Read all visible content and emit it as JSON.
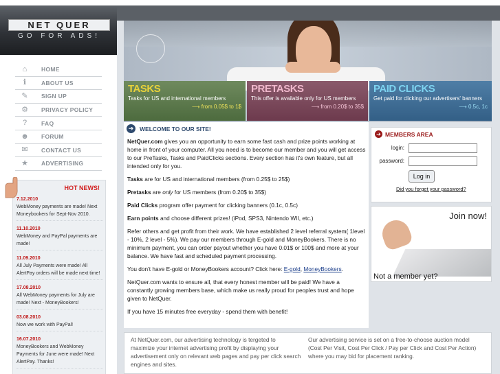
{
  "logo": {
    "name": "NET QUER",
    "tagline": "GO FOR ADS!"
  },
  "nav": [
    {
      "label": "HOME",
      "icon": "home-icon",
      "glyph": "⌂"
    },
    {
      "label": "ABOUT US",
      "icon": "info-icon",
      "glyph": "ℹ"
    },
    {
      "label": "SIGN UP",
      "icon": "pencil-icon",
      "glyph": "✎"
    },
    {
      "label": "PRIVACY POLICY",
      "icon": "gears-icon",
      "glyph": "⚙"
    },
    {
      "label": "FAQ",
      "icon": "question-icon",
      "glyph": "?"
    },
    {
      "label": "FORUM",
      "icon": "people-icon",
      "glyph": "☻"
    },
    {
      "label": "CONTACT US",
      "icon": "envelope-icon",
      "glyph": "✉"
    },
    {
      "label": "ADVERTISING",
      "icon": "star-icon",
      "glyph": "★"
    }
  ],
  "news": {
    "title": "HOT NEWS!",
    "items": [
      {
        "date": "7.12.2010",
        "text": "WebMoney payments are made! Next Moneybookers for Sept-Nov 2010."
      },
      {
        "date": "11.10.2010",
        "text": "WebMoney and PayPal payments are made!"
      },
      {
        "date": "11.09.2010",
        "text": "All July Payments were made! All AlertPay orders will be made next time!"
      },
      {
        "date": "17.08.2010",
        "text": "All WebMoney payments for July are made! Next - MoneyBookers!"
      },
      {
        "date": "03.08.2010",
        "text": "Now we work with PayPal!"
      },
      {
        "date": "16.07.2010",
        "text": "MoneyBookers and WebMoney Payments for June were made! Next AlertPay. Thanks!"
      }
    ]
  },
  "panels": [
    {
      "title": "TASKS",
      "text": "Tasks for US and international members",
      "price": "from 0.05$ to 1$"
    },
    {
      "title": "PRETASKS",
      "text": "This offer is available only for US members",
      "price": "from 0.20$ to 35$"
    },
    {
      "title": "PAID CLICKS",
      "text": "Get paid for clicking our advertisers' banners",
      "price": "0.5c, 1c"
    }
  ],
  "welcome": {
    "title": "WELCOME TO OUR SITE!",
    "p1_brand": "NetQuer.com",
    "p1_rest": " gives you an opportunity to earn some fast cash and prize points working at home in front of your computer. All you need is to become our member and you will get access to our PreTasks, Tasks and PaidClicks sections. Every section has it's own feature, but all intended only for you.",
    "p2_bold": "Tasks",
    "p2_rest": " are for US and international members (from 0.25$ to 25$)",
    "p3_bold": "Pretasks",
    "p3_mid": " are ",
    "p3_ital": "only",
    "p3_rest": " for US members (from 0.20$ to 35$)",
    "p4_bold": "Paid Clicks",
    "p4_rest": " program offer payment for clicking banners (0.1c, 0.5c)",
    "p5_bold": "Earn points",
    "p5_rest": " and choose different prizes! (iPod, SPS3, Nintendo WII, etc.)",
    "p6": "Refer others and get profit from their work. We have established 2 level referral system( 1level - 10%, 2 level - 5%). We pay our members through E-gold and MoneyBookers. There is no minimum payment, you can order payout whether you have 0.01$ or 100$ and more at your balance. We have fast and scheduled payment processing.",
    "p7_pre": "You don't have E-gold or MoneyBookers account? Click here: ",
    "p7_link1": "E-gold",
    "p7_sep": ", ",
    "p7_link2": "MoneyBookers",
    "p7_post": ".",
    "p8": "NetQuer.com wants to ensure all, that every honest member will be paid! We have a constantly growing members base, which make us really proud for peoples trust and hope given to NetQuer.",
    "p9": "If you have 15 minutes free everyday - spend them with benefit!"
  },
  "members": {
    "title": "MEMBERS AREA",
    "login_label": "login:",
    "password_label": "password:",
    "login_value": "",
    "password_value": "",
    "button": "Log in",
    "forgot": "Did you forget your password?"
  },
  "join": {
    "now": "Join now!",
    "question": "Not a member yet?"
  },
  "footer": {
    "col1": "At NetQuer.com, our advertising technology is tergeted to maximize your internet advertising profit by displaying your advertisement only on relevant web pages and pay per click search engines and sites.",
    "col2": "Our advertising service is set on a free-to-choose auction model (Cost Per Visit, Cost Per Click / Pay per Click and Cost Per Action) where you may bid for placement ranking."
  }
}
